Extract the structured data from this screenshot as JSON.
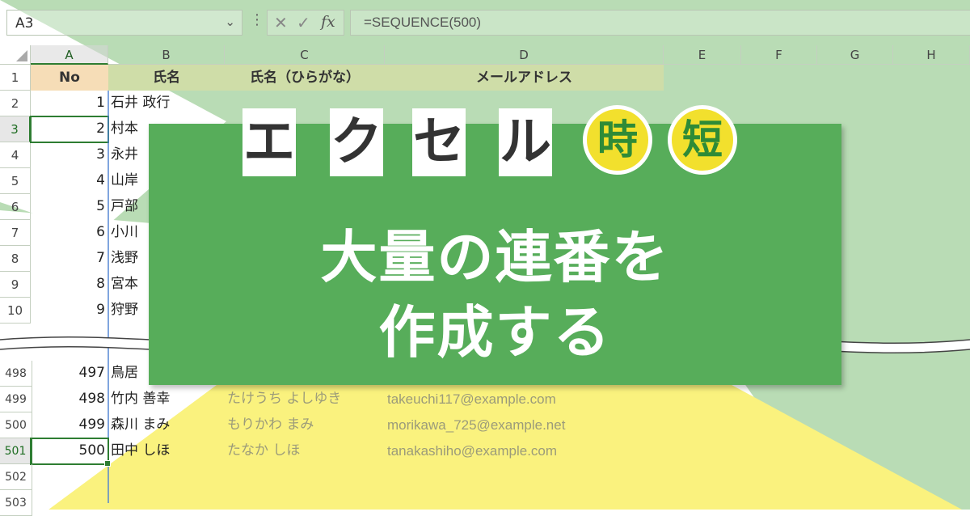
{
  "formula_bar": {
    "name_box": "A3",
    "formula": "=SEQUENCE(500)"
  },
  "columns": [
    "A",
    "B",
    "C",
    "D",
    "E",
    "F",
    "G",
    "H"
  ],
  "header_row": {
    "row_number": "1",
    "no": "No",
    "name": "氏名",
    "kana": "氏名（ひらがな）",
    "email": "メールアドレス"
  },
  "top_rows": [
    {
      "row": "2",
      "no": "1",
      "name": "石井 政行"
    },
    {
      "row": "3",
      "no": "2",
      "name": "村本"
    },
    {
      "row": "4",
      "no": "3",
      "name": "永井"
    },
    {
      "row": "5",
      "no": "4",
      "name": "山岸"
    },
    {
      "row": "6",
      "no": "5",
      "name": "戸部"
    },
    {
      "row": "7",
      "no": "6",
      "name": "小川"
    },
    {
      "row": "8",
      "no": "7",
      "name": "浅野"
    },
    {
      "row": "9",
      "no": "8",
      "name": "宮本"
    },
    {
      "row": "10",
      "no": "9",
      "name": "狩野"
    }
  ],
  "bottom_rows": [
    {
      "row": "498",
      "no": "497",
      "name": "鳥居",
      "kana": "",
      "email": ""
    },
    {
      "row": "499",
      "no": "498",
      "name": "竹内 善幸",
      "kana": "たけうち よしゆき",
      "email": "takeuchi117@example.com"
    },
    {
      "row": "500",
      "no": "499",
      "name": "森川 まみ",
      "kana": "もりかわ まみ",
      "email": "morikawa_725@example.net"
    },
    {
      "row": "501",
      "no": "500",
      "name": "田中 しほ",
      "kana": "たなか しほ",
      "email": "tanakashiho@example.com"
    },
    {
      "row": "502",
      "no": "",
      "name": "",
      "kana": "",
      "email": ""
    },
    {
      "row": "503",
      "no": "",
      "name": "",
      "kana": "",
      "email": ""
    }
  ],
  "banner": {
    "series_chars": [
      "エ",
      "ク",
      "セ",
      "ル"
    ],
    "badges": [
      "時",
      "短"
    ],
    "title_line1": "大量の連番を",
    "title_line2": "作成する"
  },
  "colors": {
    "banner_green": "#57ad5a",
    "bg_green": "#b9dcb5",
    "bg_yellow": "#faf27e",
    "badge_yellow": "#f2e02d"
  }
}
